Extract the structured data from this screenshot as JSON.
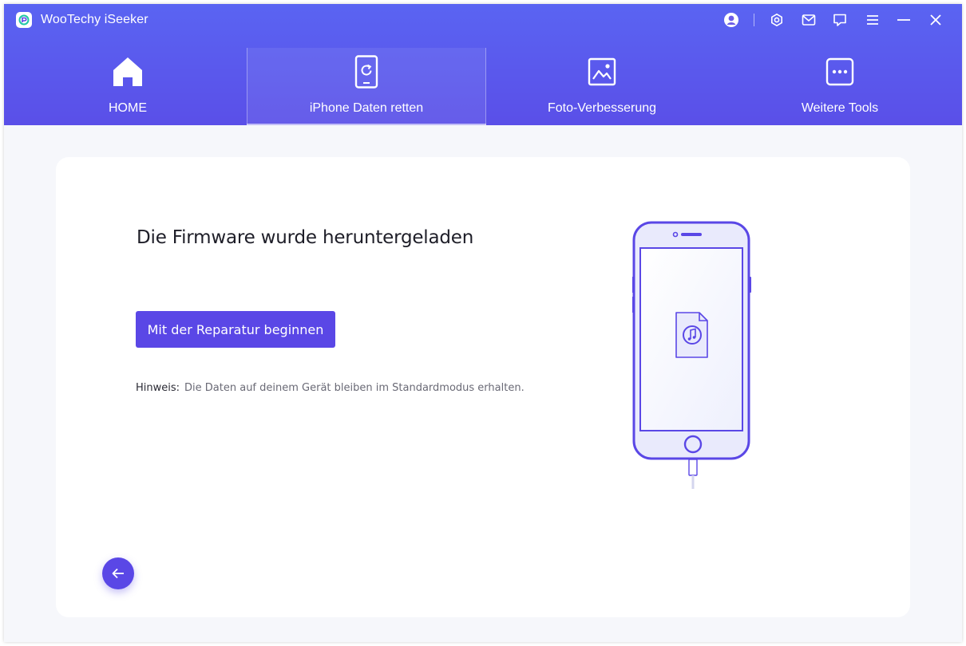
{
  "app": {
    "title": "WooTechy iSeeker"
  },
  "titlebar": {
    "icons": [
      "user-icon",
      "settings-icon",
      "mail-icon",
      "feedback-icon",
      "menu-icon",
      "minimize-icon",
      "close-icon"
    ]
  },
  "tabs": [
    {
      "label": "HOME",
      "icon": "home-icon",
      "active": false
    },
    {
      "label": "iPhone Daten retten",
      "icon": "phone-recover-icon",
      "active": true
    },
    {
      "label": "Foto-Verbesserung",
      "icon": "photo-icon",
      "active": false
    },
    {
      "label": "Weitere Tools",
      "icon": "more-tools-icon",
      "active": false
    }
  ],
  "main": {
    "heading": "Die Firmware wurde heruntergeladen",
    "primary_button": "Mit der Reparatur beginnen",
    "note_label": "Hinweis:",
    "note_text": "Die Daten auf deinem Gerät bleiben im Standardmodus erhalten."
  },
  "colors": {
    "header_gradient_top": "#5a64f2",
    "header_gradient_bottom": "#5a4fe8",
    "accent": "#5a47e6",
    "page_bg": "#f6f7fb"
  }
}
